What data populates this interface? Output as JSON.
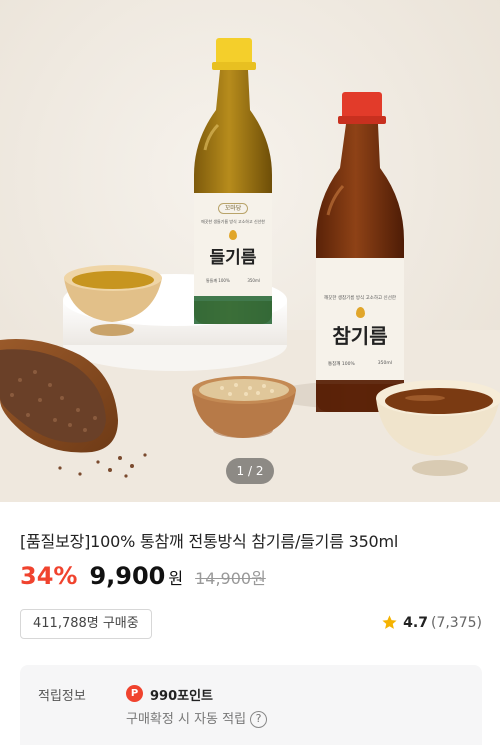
{
  "hero": {
    "pager": "1 / 2",
    "bottle_left": {
      "brand": "꼬마당",
      "tagline": "깨끗한 생들기름 방식 고소하고 신선한",
      "name": "들기름",
      "spec_left": "통들깨 100%",
      "spec_right": "350ml"
    },
    "bottle_right": {
      "brand": "",
      "tagline": "깨끗한 생참기름 방식 고소하고 신선한",
      "name": "참기름",
      "spec_left": "통참깨 100%",
      "spec_right": "350ml"
    },
    "colors": {
      "cap_left": "#f4cf2b",
      "cap_right": "#e23b2a",
      "perilla_oil": "#9c7312",
      "sesame_oil": "#7a3310"
    }
  },
  "product": {
    "title": "[품질보장]100% 통참깨 전통방식 참기름/들기름 350ml",
    "discount": "34%",
    "price": "9,900",
    "currency": "원",
    "original_price": "14,900원",
    "buyers": "411,788명 구매중",
    "rating": "4.7",
    "review_count": "(7,375)"
  },
  "points": {
    "label": "적립정보",
    "badge": "P",
    "value": "990포인트",
    "note": "구매확정 시 자동 적립",
    "help": "?"
  },
  "colors": {
    "accent": "#f0432e",
    "star": "#f5b301"
  }
}
